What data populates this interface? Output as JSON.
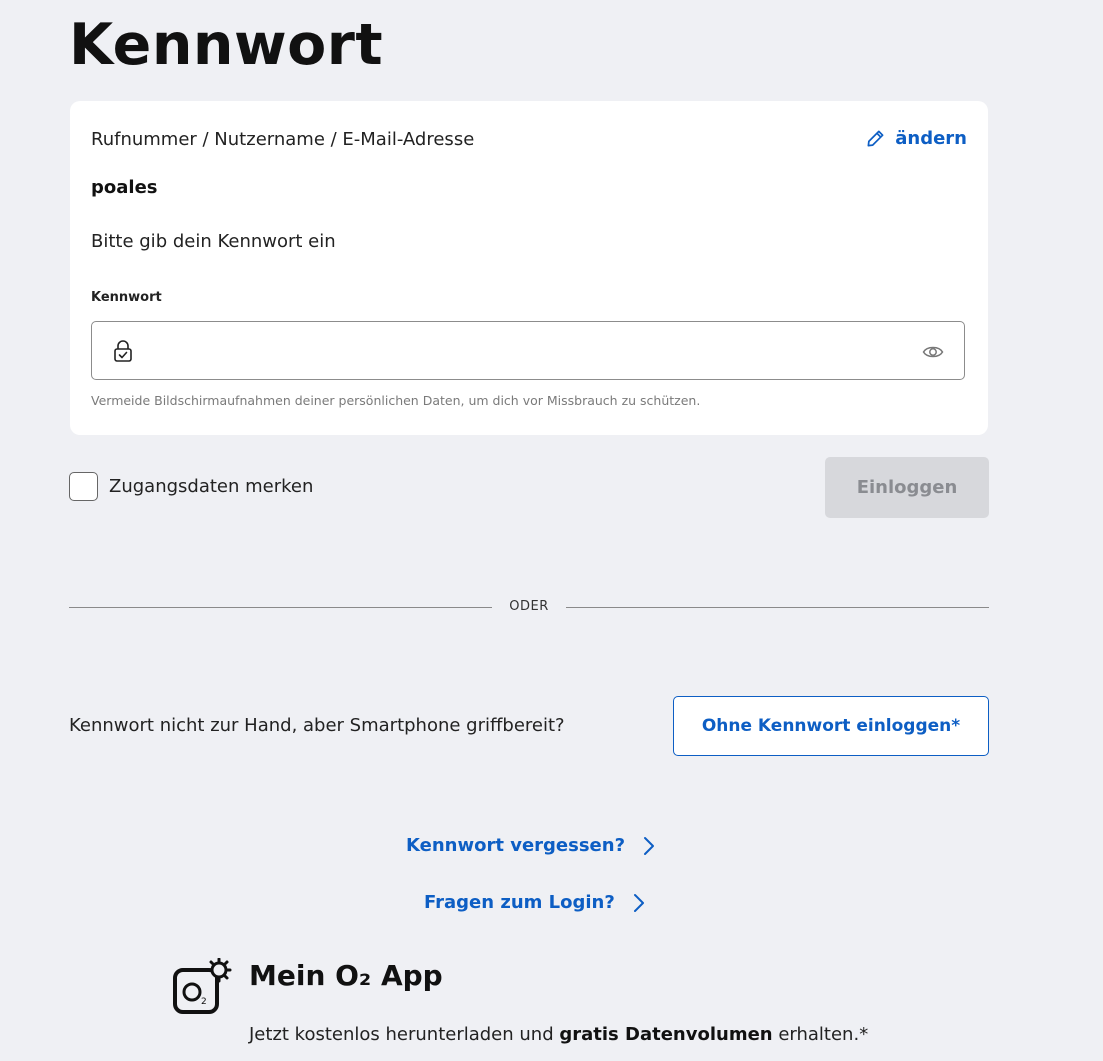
{
  "page": {
    "title": "Kennwort"
  },
  "card": {
    "identifier_label": "Rufnummer / Nutzername / E-Mail-Adresse",
    "change_label": "ändern",
    "username": "poales",
    "instruction": "Bitte gib dein Kennwort ein",
    "password_label": "Kennwort",
    "password_value": "",
    "hint": "Vermeide Bildschirmaufnahmen deiner persönlichen Daten, um dich vor Missbrauch zu schützen."
  },
  "form": {
    "remember_label": "Zugangsdaten merken",
    "remember_checked": false,
    "login_label": "Einloggen",
    "login_enabled": false
  },
  "divider": {
    "text": "ODER"
  },
  "passwordless": {
    "prompt": "Kennwort nicht zur Hand, aber Smartphone griffbereit?",
    "button_label": "Ohne Kennwort einloggen*"
  },
  "links": {
    "forgot": "Kennwort vergessen?",
    "questions": "Fragen zum Login?"
  },
  "app_promo": {
    "title": "Mein O₂ App",
    "sub_prefix": "Jetzt kostenlos herunterladen und ",
    "sub_bold": "gratis Datenvolumen",
    "sub_suffix": " erhalten.*"
  },
  "icons": {
    "edit": "pencil-icon",
    "lock": "lock-icon",
    "visibility": "eye-icon",
    "chevron": "chevron-right-icon",
    "app_logo": "o2-app-logo"
  },
  "colors": {
    "background": "#eff0f4",
    "accent": "#0d5ec4",
    "disabled_button": "#d7d8dc",
    "disabled_text": "#8a8c91"
  }
}
